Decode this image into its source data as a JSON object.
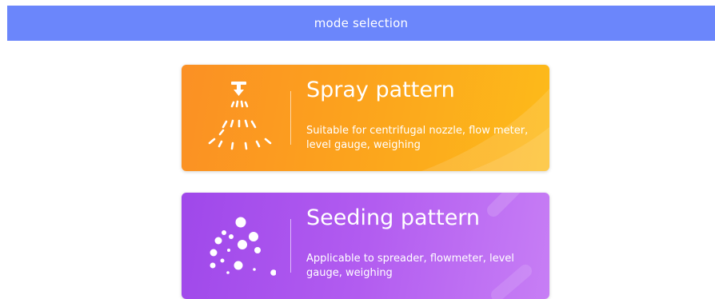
{
  "header": {
    "title": "mode selection",
    "color": "#6b86fb"
  },
  "cards": [
    {
      "id": "spray",
      "title": "Spray pattern",
      "description": "Suitable for centrifugal nozzle, flow meter, level gauge, weighing",
      "icon": "spray-nozzle-icon",
      "gradient": [
        "#fb9024",
        "#fdbb1a"
      ]
    },
    {
      "id": "seeding",
      "title": "Seeding pattern",
      "description": "Applicable to spreader, flowmeter, level gauge, weighing",
      "icon": "seed-dots-icon",
      "gradient": [
        "#9f48ea",
        "#c77ef5"
      ]
    }
  ]
}
